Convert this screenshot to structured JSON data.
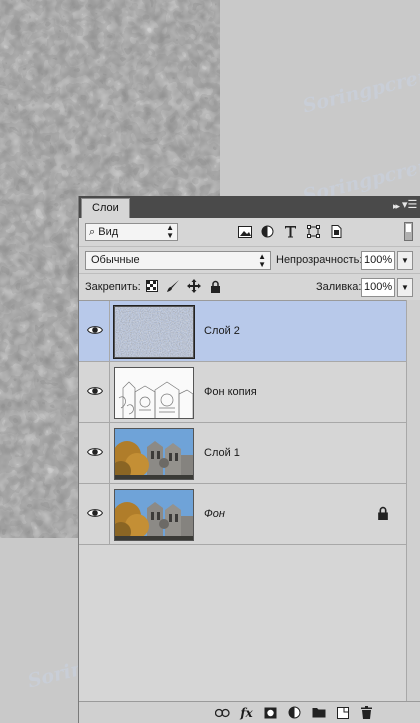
{
  "panel": {
    "tab_label": "Слои",
    "collapse_label": "▸▸",
    "menu_label": "▾☰"
  },
  "filter": {
    "kind_label": "Вид"
  },
  "blend": {
    "mode": "Обычные",
    "opacity_label": "Непрозрачность:",
    "opacity_value": "100%"
  },
  "lock": {
    "label": "Закрепить:",
    "fill_label": "Заливка:",
    "fill_value": "100%"
  },
  "layers": [
    {
      "name": "Слой 2",
      "selected": true,
      "italic": false,
      "locked": false,
      "thumb": "noise"
    },
    {
      "name": "Фон копия",
      "selected": false,
      "italic": false,
      "locked": false,
      "thumb": "sketch"
    },
    {
      "name": "Слой 1",
      "selected": false,
      "italic": false,
      "locked": false,
      "thumb": "photo"
    },
    {
      "name": "Фон",
      "selected": false,
      "italic": true,
      "locked": true,
      "thumb": "photo"
    }
  ],
  "bottom": {
    "fx_label": "fx"
  },
  "watermark_text": "Soringpcrepair.Com",
  "colors": {
    "selection": "#b8c9ea",
    "panel_bg": "#d6d6d6",
    "tab_bar": "#4a4a4a"
  }
}
